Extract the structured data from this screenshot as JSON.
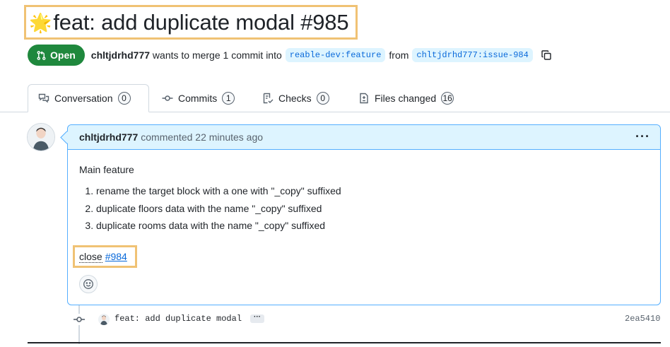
{
  "pr": {
    "title_emoji": "🌟",
    "title": "feat: add duplicate modal #985",
    "state": "Open",
    "author": "chltjdrhd777",
    "merge_text": "wants to merge 1 commit into",
    "base_branch": "reable-dev:feature",
    "from_text": "from",
    "head_branch": "chltjdrhd777:issue-984"
  },
  "tabs": [
    {
      "label": "Conversation",
      "count": "0",
      "icon": "comment-discussion-icon"
    },
    {
      "label": "Commits",
      "count": "1",
      "icon": "git-commit-icon"
    },
    {
      "label": "Checks",
      "count": "0",
      "icon": "checklist-icon"
    },
    {
      "label": "Files changed",
      "count": "16",
      "icon": "file-diff-icon"
    }
  ],
  "comment": {
    "author": "chltjdrhd777",
    "action": "commented",
    "time": "22 minutes ago",
    "body_intro": "Main feature",
    "items": [
      "rename the target block with a one with \"_copy\" suffixed",
      "duplicate floors data with the name \"_copy\" suffixed",
      "duplicate rooms data with the name \"_copy\" suffixed"
    ],
    "close_word": "close",
    "close_issue": "#984"
  },
  "commit": {
    "message": "feat: add duplicate modal",
    "ellipsis": "···",
    "sha": "2ea5410"
  },
  "colors": {
    "open_green": "#1f883d",
    "highlight_border": "#f0c274",
    "link_blue": "#0969da",
    "comment_header_bg": "#ddf4ff"
  }
}
